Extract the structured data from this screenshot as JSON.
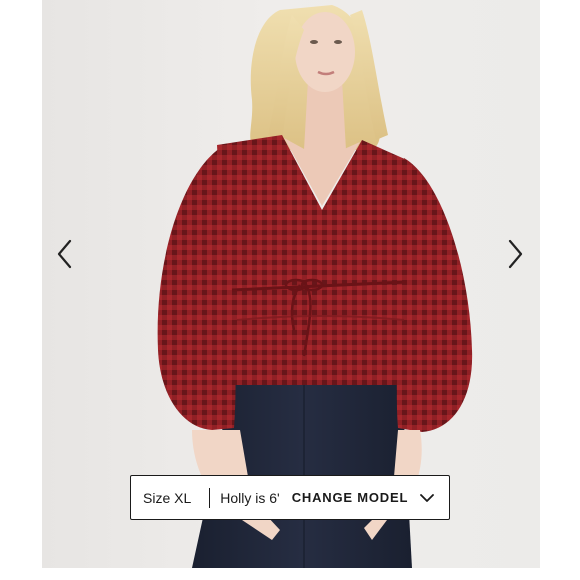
{
  "product_image": {
    "alt_subject": "model-wearing-red-gingham-blouse"
  },
  "carousel": {
    "prev_icon": "chevron-left-icon",
    "next_icon": "chevron-right-icon"
  },
  "model_info": {
    "size_label": "Size XL",
    "model_label": "Holly is 6'",
    "change_button_label": "CHANGE MODEL",
    "change_icon": "chevron-down-icon"
  },
  "colors": {
    "blouse_red": "#a6262b",
    "blouse_dark": "#5e1418",
    "jeans": "#1f2536",
    "hair": "#e8d39a",
    "skin": "#f1d6c6",
    "background": "#ecebe9",
    "text": "#1a1a1a"
  }
}
